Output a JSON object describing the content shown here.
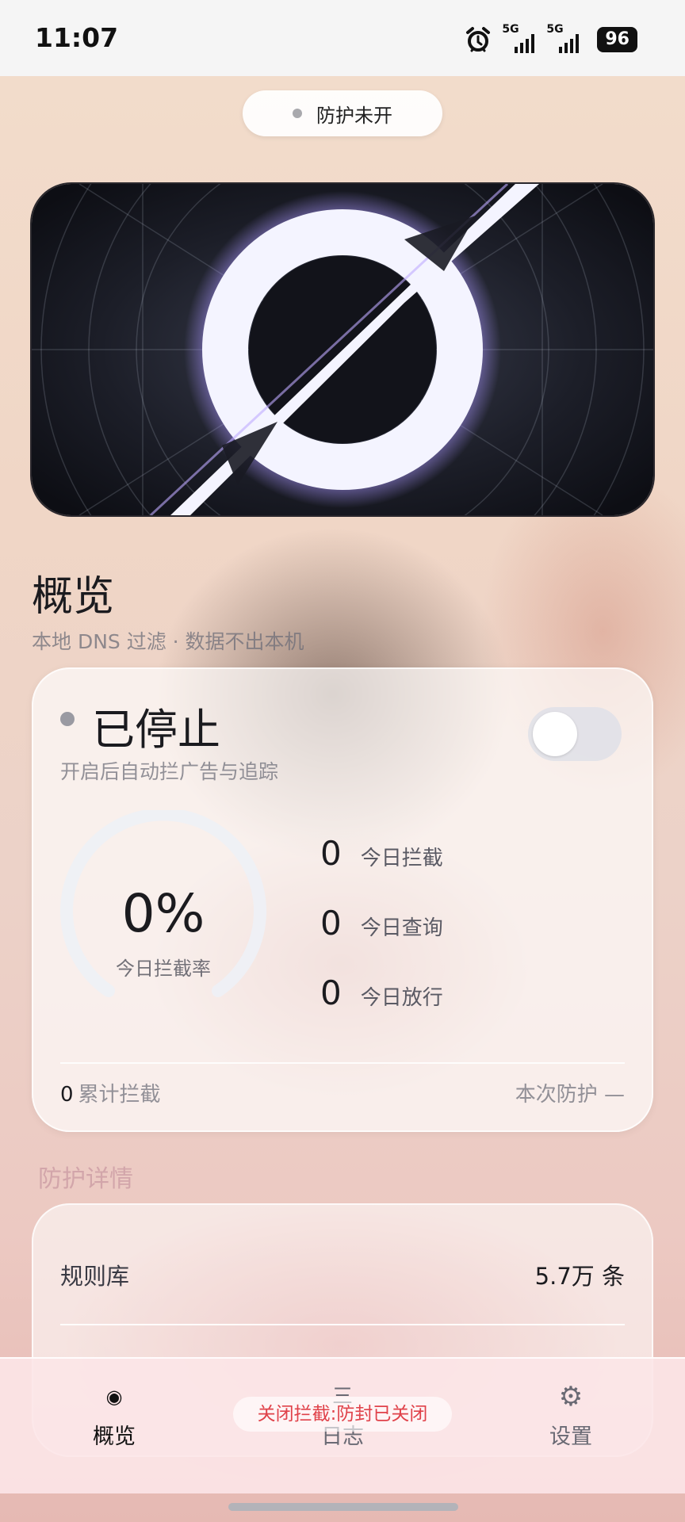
{
  "status_bar": {
    "time": "11:07",
    "network1": "5G",
    "network2": "5G",
    "battery": "96"
  },
  "protection_pill": {
    "text": "防护未开"
  },
  "overview": {
    "title": "概览",
    "subtitle": "本地 DNS 过滤 · 数据不出本机"
  },
  "status_card": {
    "status_title": "已停止",
    "status_subtitle": "开启后自动拦广告与追踪",
    "toggle_on": false,
    "gauge": {
      "percent_text": "0%",
      "label": "今日拦截率",
      "value": 0
    },
    "stats": [
      {
        "value": "0",
        "label": "今日拦截"
      },
      {
        "value": "0",
        "label": "今日查询"
      },
      {
        "value": "0",
        "label": "今日放行"
      }
    ],
    "footer_total_value": "0",
    "footer_total_label": "累计拦截",
    "footer_session": "本次防护 —"
  },
  "details": {
    "title": "防护详情",
    "rows": [
      {
        "key": "规则库",
        "value": "5.7万 条"
      }
    ]
  },
  "bottom_nav": {
    "items": [
      {
        "label": "概览",
        "icon": "◉"
      },
      {
        "label": "日志",
        "icon": "三"
      },
      {
        "label": "设置",
        "icon": "⚙"
      }
    ]
  },
  "toast": {
    "text": "关闭拦截:防封已关闭"
  },
  "colors": {
    "toast_text": "#e0424a",
    "accent_dark": "#1b1b1f",
    "inactive_dot": "#a9a9ad"
  }
}
